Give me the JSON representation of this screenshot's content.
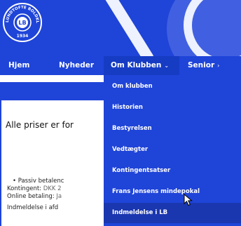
{
  "colors": {
    "brand_blue": "#1f44d8",
    "active_blue": "#1a37b0",
    "text_white": "#ffffff"
  },
  "logo": {
    "icon": "club-crest-icon",
    "text_top": "LUNDTOFTE BOLDKLUB",
    "year": "1934",
    "monogram": "LB"
  },
  "nav": {
    "items": [
      {
        "label": "Hjem"
      },
      {
        "label": "Nyheder"
      },
      {
        "label": "Om Klubben",
        "chevron": "⌄"
      },
      {
        "label": "Senior",
        "chevron": "›"
      }
    ]
  },
  "dropdown": {
    "items": [
      {
        "label": "Om klubben"
      },
      {
        "label": "Historien"
      },
      {
        "label": "Bestyrelsen"
      },
      {
        "label": "Vedtægter"
      },
      {
        "label": "Kontingentsatser"
      },
      {
        "label": "Frans Jensens mindepokal"
      },
      {
        "label": "Indmeldelse i LB"
      }
    ],
    "active_index": 6
  },
  "content": {
    "heading": "Alle priser er for",
    "passiv": "Passiv betalenc",
    "kontingent_label": "Kontingent: ",
    "kontingent_value": "DKK 2",
    "online_label": "Online betaling: ",
    "online_value": "Ja",
    "indmeldelse": "Indmeldelse i afd"
  }
}
